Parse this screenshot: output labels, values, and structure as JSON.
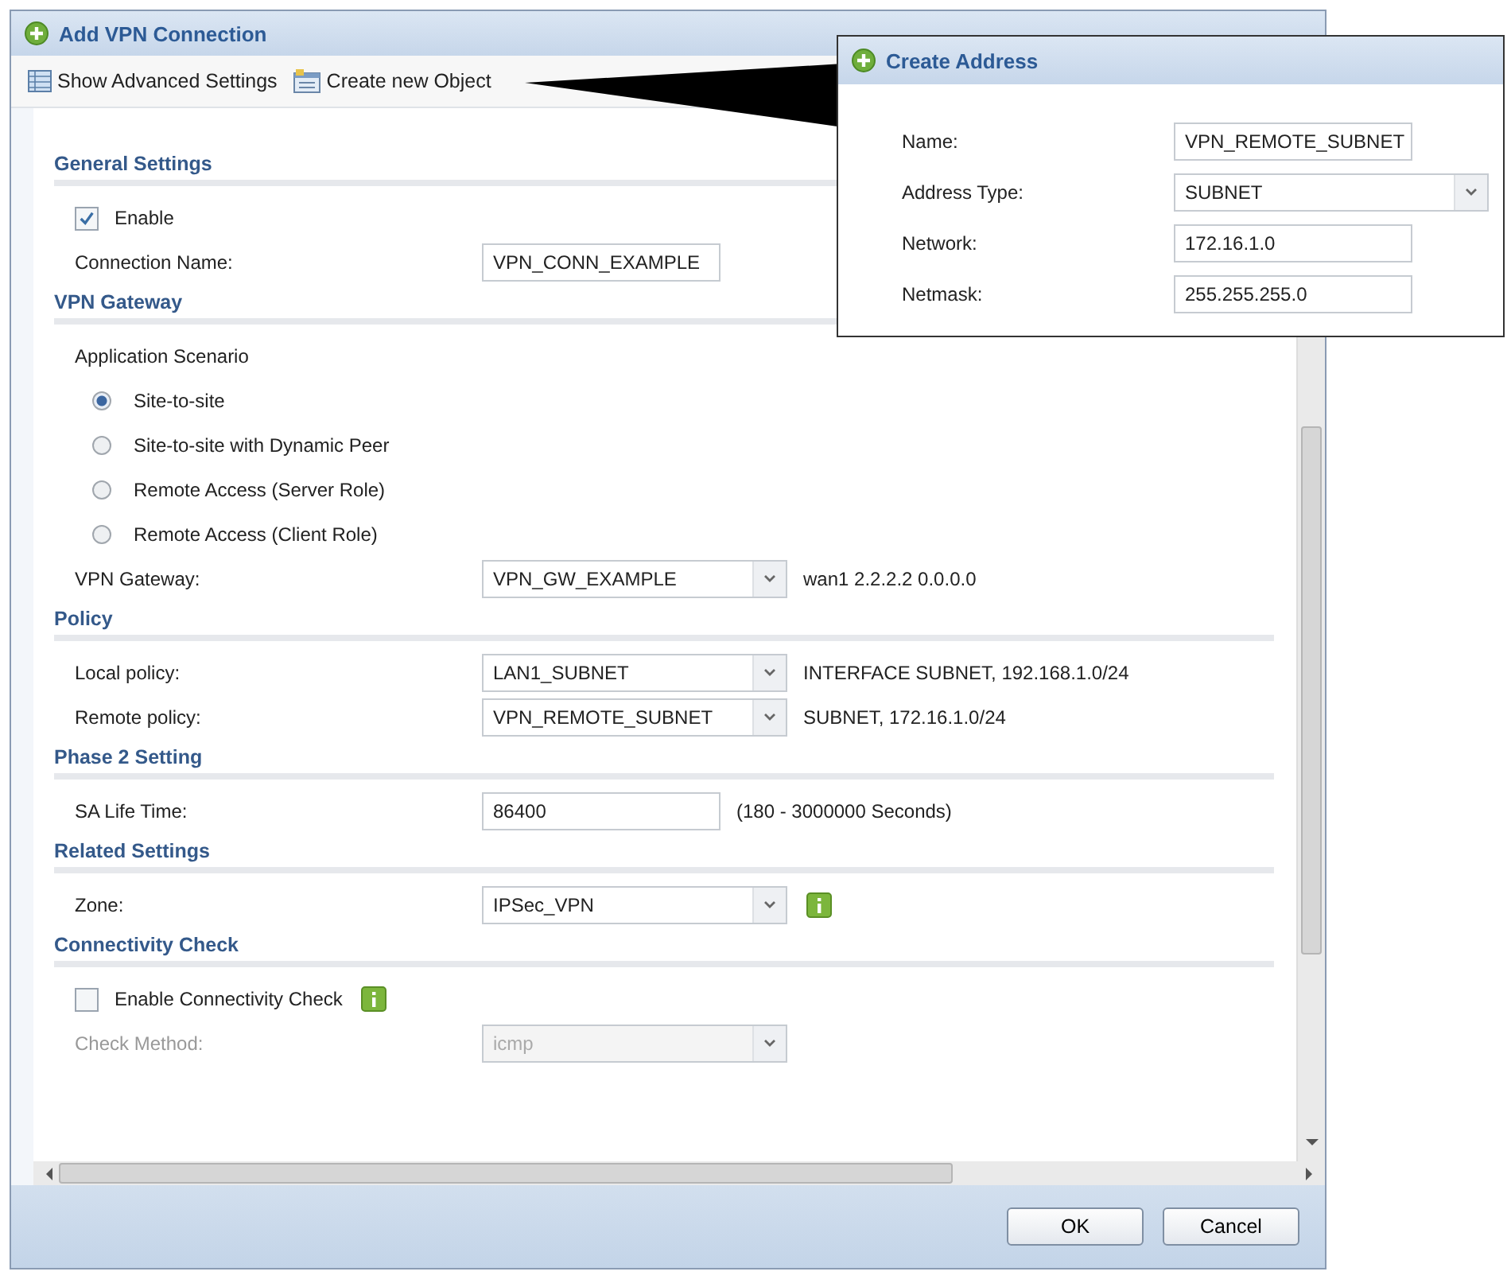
{
  "dialog": {
    "title": "Add VPN Connection",
    "toolbar": [
      {
        "kind": "grid",
        "label": "Show Advanced Settings"
      },
      {
        "kind": "object",
        "label": "Create new Object"
      }
    ]
  },
  "sections": [
    {
      "title": "General Settings",
      "rows": [
        {
          "kind": "checkbox",
          "label": "Enable",
          "checked": true
        },
        {
          "kind": "text",
          "label": "Connection Name:",
          "value": "VPN_CONN_EXAMPLE"
        }
      ]
    },
    {
      "title": "VPN Gateway",
      "rows": [
        {
          "kind": "heading",
          "label": "Application Scenario"
        },
        {
          "kind": "radio",
          "label": "Site-to-site",
          "selected": true
        },
        {
          "kind": "radio",
          "label": "Site-to-site with Dynamic Peer",
          "selected": false
        },
        {
          "kind": "radio",
          "label": "Remote Access (Server Role)",
          "selected": false
        },
        {
          "kind": "radio",
          "label": "Remote Access (Client Role)",
          "selected": false
        },
        {
          "kind": "select",
          "label": "VPN Gateway:",
          "value": "VPN_GW_EXAMPLE",
          "note": "wan1 2.2.2.2 0.0.0.0"
        }
      ]
    },
    {
      "title": "Policy",
      "rows": [
        {
          "kind": "select",
          "label": "Local policy:",
          "value": "LAN1_SUBNET",
          "note": "INTERFACE SUBNET, 192.168.1.0/24"
        },
        {
          "kind": "select",
          "label": "Remote policy:",
          "value": "VPN_REMOTE_SUBNET",
          "note": "SUBNET, 172.16.1.0/24"
        }
      ]
    },
    {
      "title": "Phase 2 Setting",
      "rows": [
        {
          "kind": "text",
          "label": "SA Life Time:",
          "value": "86400",
          "note": "(180 - 3000000 Seconds)"
        }
      ]
    },
    {
      "title": "Related Settings",
      "rows": [
        {
          "kind": "select",
          "label": "Zone:",
          "value": "IPSec_VPN",
          "info": true
        }
      ]
    },
    {
      "title": "Connectivity Check",
      "rows": [
        {
          "kind": "checkbox",
          "label": "Enable Connectivity Check",
          "checked": false,
          "info": true
        },
        {
          "kind": "select",
          "label": "Check Method:",
          "value": "icmp",
          "disabled": true
        }
      ]
    }
  ],
  "buttons": [
    "OK",
    "Cancel"
  ],
  "popup": {
    "title": "Create Address",
    "fields": [
      {
        "kind": "text",
        "label": "Name:",
        "value": "VPN_REMOTE_SUBNET"
      },
      {
        "kind": "select",
        "label": "Address Type:",
        "value": "SUBNET"
      },
      {
        "kind": "text",
        "label": "Network:",
        "value": "172.16.1.0"
      },
      {
        "kind": "text",
        "label": "Netmask:",
        "value": "255.255.255.0"
      }
    ]
  }
}
